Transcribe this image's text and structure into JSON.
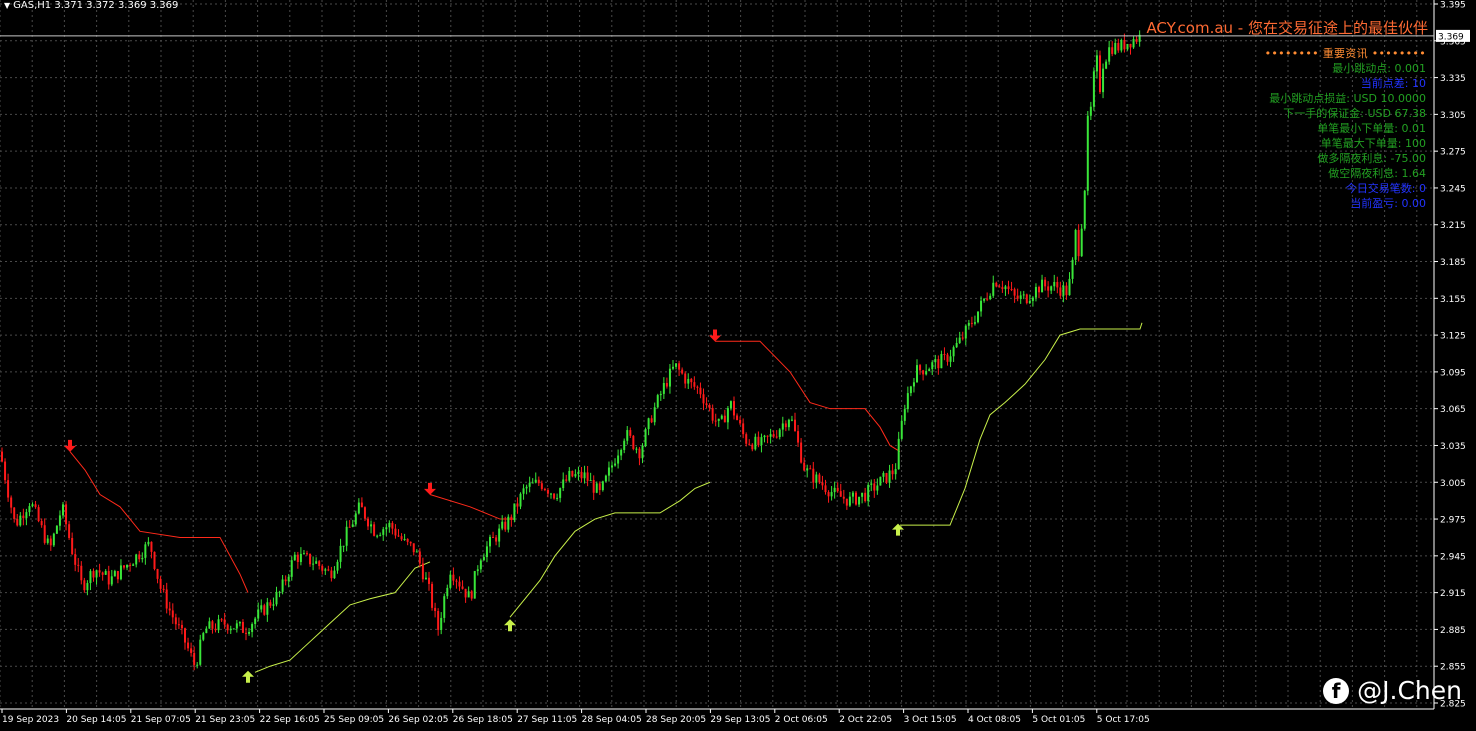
{
  "header": {
    "symbol_line": "GAS,H1  3.371 3.372 3.369 3.369",
    "price_marker": "3.369"
  },
  "brand": {
    "text": "ACY.com.au - 您在交易征途上的最佳伙伴"
  },
  "info_panel": {
    "title": "•••••••• 重要资讯 ••••••••",
    "lines": [
      {
        "text": "最小跳动点: 0.001",
        "color": "#22a022"
      },
      {
        "text": "当前点差: 10",
        "color": "#2233ff"
      },
      {
        "text": "最小跳动点损益: USD 10.0000",
        "color": "#22a022"
      },
      {
        "text": "下一手的保证金: USD 67.38",
        "color": "#22a022"
      },
      {
        "text": "单笔最小下单量: 0.01",
        "color": "#22a022"
      },
      {
        "text": "单笔最大下单量: 100",
        "color": "#22a022"
      },
      {
        "text": "做多隔夜利息: -75.00",
        "color": "#22a022"
      },
      {
        "text": "做空隔夜利息: 1.64",
        "color": "#22a022"
      },
      {
        "text": "今日交易笔数: 0",
        "color": "#2233ff"
      },
      {
        "text": "当前盈亏: 0.00",
        "color": "#2233ff"
      }
    ]
  },
  "watermark": {
    "icon": "facebook-icon",
    "text": "@J.Chen"
  },
  "colors": {
    "background": "#000000",
    "grid": "#4a4a4a",
    "bull": "#39e639",
    "bear": "#ff1a1a",
    "up_trail": "#c8f04a",
    "down_trail": "#ff2a1a",
    "axis_text": "#ffffff"
  },
  "chart_data": {
    "type": "candlestick",
    "symbol": "GAS",
    "timeframe": "H1",
    "x_tick_labels": [
      "19 Sep 2023",
      "20 Sep 14:05",
      "21 Sep 07:05",
      "21 Sep 23:05",
      "22 Sep 16:05",
      "25 Sep 09:05",
      "26 Sep 02:05",
      "26 Sep 18:05",
      "27 Sep 11:05",
      "28 Sep 04:05",
      "28 Sep 20:05",
      "29 Sep 13:05",
      "2 Oct 06:05",
      "2 Oct 22:05",
      "3 Oct 15:05",
      "4 Oct 08:05",
      "5 Oct 01:05",
      "5 Oct 17:05"
    ],
    "y_tick_labels": [
      "3.395",
      "3.365",
      "3.335",
      "3.305",
      "3.275",
      "3.245",
      "3.215",
      "3.185",
      "3.155",
      "3.125",
      "3.095",
      "3.065",
      "3.035",
      "3.005",
      "2.975",
      "2.945",
      "2.915",
      "2.885",
      "2.855",
      "2.825"
    ],
    "ylim": [
      2.825,
      3.395
    ],
    "current_price": 3.369,
    "grid": true,
    "price_path": [
      [
        0,
        3.03
      ],
      [
        15,
        2.97
      ],
      [
        30,
        2.99
      ],
      [
        50,
        2.95
      ],
      [
        62,
        2.985
      ],
      [
        72,
        2.95
      ],
      [
        82,
        2.92
      ],
      [
        95,
        2.935
      ],
      [
        110,
        2.925
      ],
      [
        130,
        2.94
      ],
      [
        150,
        2.955
      ],
      [
        160,
        2.92
      ],
      [
        170,
        2.9
      ],
      [
        185,
        2.875
      ],
      [
        195,
        2.855
      ],
      [
        205,
        2.885
      ],
      [
        225,
        2.89
      ],
      [
        245,
        2.885
      ],
      [
        262,
        2.9
      ],
      [
        280,
        2.915
      ],
      [
        295,
        2.945
      ],
      [
        315,
        2.94
      ],
      [
        330,
        2.93
      ],
      [
        345,
        2.96
      ],
      [
        360,
        2.985
      ],
      [
        375,
        2.965
      ],
      [
        390,
        2.97
      ],
      [
        405,
        2.955
      ],
      [
        415,
        2.95
      ],
      [
        428,
        2.92
      ],
      [
        438,
        2.885
      ],
      [
        450,
        2.935
      ],
      [
        462,
        2.92
      ],
      [
        470,
        2.91
      ],
      [
        480,
        2.945
      ],
      [
        495,
        2.96
      ],
      [
        510,
        2.975
      ],
      [
        525,
        3.0
      ],
      [
        540,
        3.005
      ],
      [
        555,
        2.995
      ],
      [
        570,
        3.01
      ],
      [
        585,
        3.01
      ],
      [
        600,
        2.995
      ],
      [
        615,
        3.025
      ],
      [
        625,
        3.045
      ],
      [
        640,
        3.03
      ],
      [
        652,
        3.06
      ],
      [
        665,
        3.085
      ],
      [
        675,
        3.1
      ],
      [
        690,
        3.085
      ],
      [
        700,
        3.08
      ],
      [
        712,
        3.06
      ],
      [
        720,
        3.05
      ],
      [
        730,
        3.07
      ],
      [
        745,
        3.04
      ],
      [
        760,
        3.035
      ],
      [
        775,
        3.045
      ],
      [
        790,
        3.06
      ],
      [
        805,
        3.015
      ],
      [
        820,
        3.005
      ],
      [
        835,
        2.995
      ],
      [
        850,
        2.99
      ],
      [
        865,
        2.995
      ],
      [
        880,
        3.005
      ],
      [
        895,
        3.015
      ],
      [
        905,
        3.07
      ],
      [
        915,
        3.095
      ],
      [
        930,
        3.1
      ],
      [
        945,
        3.105
      ],
      [
        960,
        3.12
      ],
      [
        975,
        3.14
      ],
      [
        985,
        3.155
      ],
      [
        995,
        3.17
      ],
      [
        1005,
        3.165
      ],
      [
        1015,
        3.155
      ],
      [
        1025,
        3.155
      ],
      [
        1040,
        3.165
      ],
      [
        1055,
        3.165
      ],
      [
        1068,
        3.16
      ],
      [
        1078,
        3.21
      ],
      [
        1088,
        3.28
      ],
      [
        1095,
        3.325
      ],
      [
        1102,
        3.345
      ],
      [
        1110,
        3.36
      ],
      [
        1120,
        3.36
      ],
      [
        1130,
        3.365
      ],
      [
        1142,
        3.369
      ]
    ],
    "up_trail": [
      [
        0,
        2.95
      ],
      [
        65,
        2.95
      ],
      [
        255,
        2.85
      ],
      [
        270,
        2.855
      ],
      [
        290,
        2.86
      ],
      [
        310,
        2.875
      ],
      [
        330,
        2.89
      ],
      [
        350,
        2.905
      ],
      [
        370,
        2.91
      ],
      [
        395,
        2.915
      ],
      [
        415,
        2.935
      ],
      [
        430,
        2.94
      ],
      [
        510,
        2.895
      ],
      [
        525,
        2.91
      ],
      [
        540,
        2.925
      ],
      [
        555,
        2.945
      ],
      [
        575,
        2.965
      ],
      [
        595,
        2.975
      ],
      [
        615,
        2.98
      ],
      [
        660,
        2.98
      ],
      [
        680,
        2.99
      ],
      [
        695,
        3.0
      ],
      [
        710,
        3.005
      ],
      [
        900,
        2.97
      ],
      [
        950,
        2.97
      ],
      [
        965,
        3.0
      ],
      [
        980,
        3.04
      ],
      [
        990,
        3.06
      ],
      [
        1005,
        3.07
      ],
      [
        1025,
        3.085
      ],
      [
        1045,
        3.105
      ],
      [
        1060,
        3.125
      ],
      [
        1080,
        3.13
      ],
      [
        1140,
        3.13
      ],
      [
        1142,
        3.135
      ]
    ],
    "down_trail": [
      [
        70,
        3.03
      ],
      [
        85,
        3.015
      ],
      [
        100,
        2.995
      ],
      [
        120,
        2.985
      ],
      [
        140,
        2.965
      ],
      [
        180,
        2.96
      ],
      [
        220,
        2.96
      ],
      [
        240,
        2.93
      ],
      [
        248,
        2.915
      ],
      [
        430,
        2.995
      ],
      [
        470,
        2.985
      ],
      [
        500,
        2.975
      ],
      [
        515,
        2.975
      ],
      [
        715,
        3.12
      ],
      [
        760,
        3.12
      ],
      [
        790,
        3.095
      ],
      [
        810,
        3.07
      ],
      [
        830,
        3.065
      ],
      [
        865,
        3.065
      ],
      [
        880,
        3.05
      ],
      [
        890,
        3.035
      ],
      [
        900,
        3.03
      ]
    ],
    "sell_arrows": [
      [
        70,
        3.033
      ],
      [
        430,
        2.998
      ],
      [
        715,
        3.123
      ]
    ],
    "buy_arrows": [
      [
        248,
        2.848
      ],
      [
        510,
        2.89
      ],
      [
        898,
        2.968
      ]
    ]
  }
}
